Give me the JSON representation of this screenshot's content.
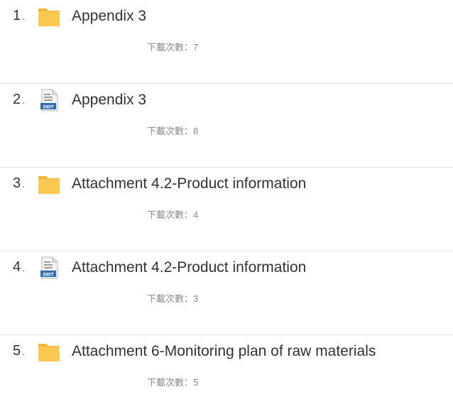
{
  "download_count_label": "下載次數",
  "separator": "：",
  "items": [
    {
      "index": "1",
      "dot": ".",
      "type": "folder",
      "icon": "folder-icon",
      "title": "Appendix 3",
      "downloads": "7"
    },
    {
      "index": "2",
      "dot": ".",
      "type": "file",
      "icon": "odt-file-icon",
      "title": "Appendix 3",
      "downloads": "8"
    },
    {
      "index": "3",
      "dot": ".",
      "type": "folder",
      "icon": "folder-icon",
      "title": "Attachment 4.2-Product information",
      "downloads": "4"
    },
    {
      "index": "4",
      "dot": ".",
      "type": "file",
      "icon": "odt-file-icon",
      "title": "Attachment 4.2-Product information",
      "downloads": "3"
    },
    {
      "index": "5",
      "dot": ".",
      "type": "folder",
      "icon": "folder-icon",
      "title": "Attachment 6-Monitoring plan of raw materials",
      "downloads": "5"
    }
  ],
  "colors": {
    "folder": "#fcc84f",
    "folder_dark": "#f0b53a",
    "odt_blue": "#2f6db5",
    "divider": "#e3e3e3",
    "meta_text": "#8a8a8a"
  }
}
